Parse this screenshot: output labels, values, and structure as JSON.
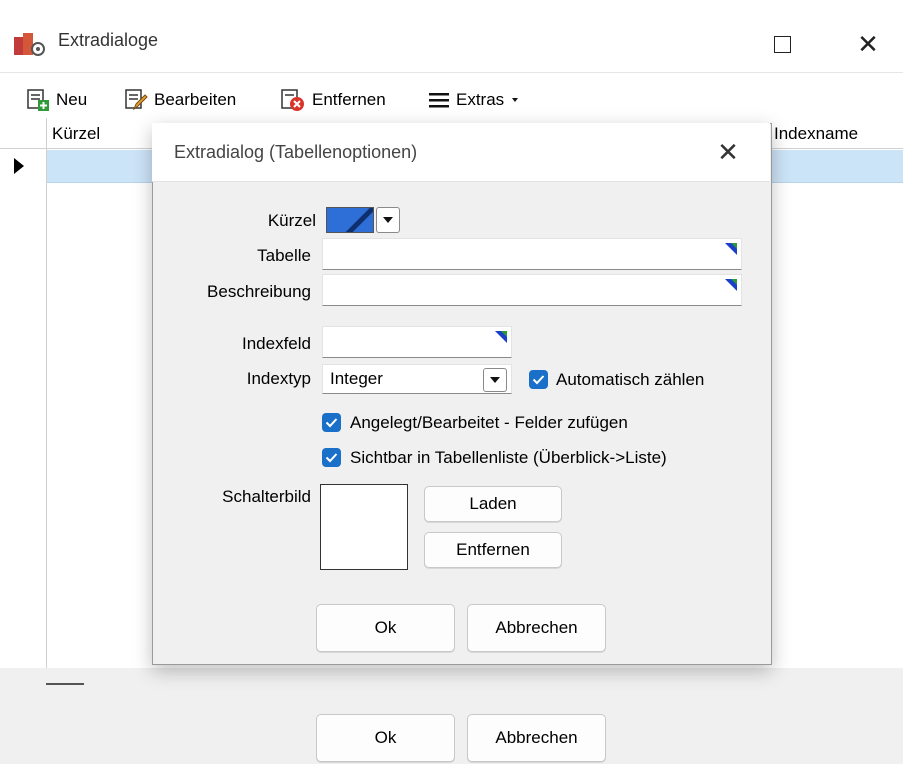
{
  "window": {
    "title": "Extradialoge",
    "maximize_label": "",
    "close_glyph": "✕"
  },
  "toolbar": {
    "new_label": "Neu",
    "edit_label": "Bearbeiten",
    "remove_label": "Entfernen",
    "extras_label": "Extras"
  },
  "grid": {
    "columns": [
      "Kürzel",
      "Indexname"
    ]
  },
  "footer": {
    "ok_label": "Ok",
    "cancel_label": "Abbrechen"
  },
  "dialog": {
    "title": "Extradialog (Tabellenoptionen)",
    "close_glyph": "✕",
    "labels": {
      "kuerzel": "Kürzel",
      "tabelle": "Tabelle",
      "beschreibung": "Beschreibung",
      "indexfeld": "Indexfeld",
      "indextyp": "Indextyp",
      "schalterbild": "Schalterbild"
    },
    "values": {
      "tabelle": "",
      "beschreibung": "",
      "indexfeld": "",
      "indextyp": "Integer"
    },
    "checkboxes": {
      "auto_count": {
        "label": "Automatisch zählen",
        "checked": true
      },
      "created_edited": {
        "label": "Angelegt/Bearbeitet - Felder zufügen",
        "checked": true
      },
      "visible_in_list": {
        "label": "Sichtbar in Tabellenliste (Überblick->Liste)",
        "checked": true
      }
    },
    "load_label": "Laden",
    "remove_image_label": "Entfernen",
    "ok_label": "Ok",
    "cancel_label": "Abbrechen"
  },
  "colors": {
    "accent": "#1a6fc9",
    "selected_row": "#cce4f7",
    "dialog_bg": "#f0f0f0"
  }
}
